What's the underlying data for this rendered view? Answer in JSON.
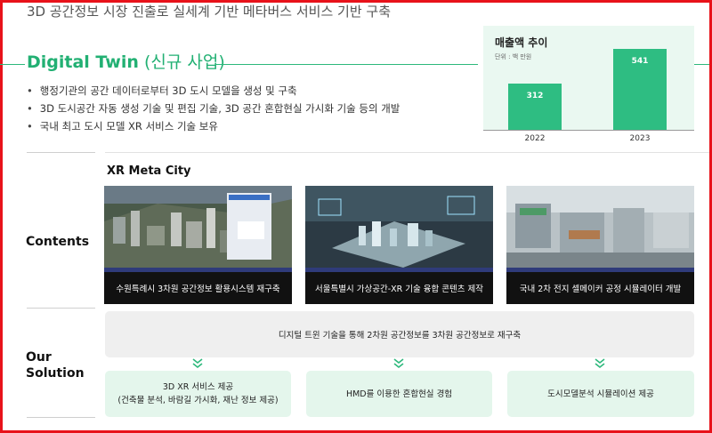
{
  "header": {
    "title": "3D 공간정보 시장 진출로 실세계 기반 메타버스 서비스 기반 구축"
  },
  "section": {
    "title_en": "Digital Twin",
    "title_ko": "(신규 사업)",
    "bullets": [
      "행정기관의 공간 데이터로부터 3D 도시 모델을 생성 및 구축",
      "3D 도시공간 자동 생성 기술 및 편집 기술, 3D 공간 혼합현실 가시화 기술 등의 개발",
      "국내 최고 도시 모델 XR 서비스 기술 보유"
    ]
  },
  "chart_data": {
    "type": "bar",
    "title": "매출액 추이",
    "unit": "단위 : 백 만원",
    "categories": [
      "2022",
      "2023"
    ],
    "values": [
      312,
      541
    ],
    "ylim": [
      0,
      541
    ],
    "colors": {
      "bar": "#2ebd82",
      "background": "#eaf8f1"
    }
  },
  "xr": {
    "title": "XR Meta City"
  },
  "contents": {
    "label": "Contents",
    "cards": [
      {
        "caption": "수원특례시 3차원 공간정보 활용시스템 재구축"
      },
      {
        "caption": "서울특별시 가상공간-XR 기술 융합 콘텐츠 제작"
      },
      {
        "caption": "국내 2차 전지  셀메이커 공정 시뮬레이터 개발"
      }
    ]
  },
  "solution": {
    "label_line1": "Our",
    "label_line2": "Solution",
    "main": "디지털 트윈 기술을 통해 2차원 공간정보를 3차원 공간정보로 재구축",
    "items": [
      {
        "line1": "3D XR 서비스 제공",
        "line2": "(건축물 분석, 바람길 가시화, 재난 정보 제공)"
      },
      {
        "line1": "HMD를 이용한 혼합현실 경험",
        "line2": ""
      },
      {
        "line1": "도시모델분석 시뮬레이션 제공",
        "line2": ""
      }
    ]
  },
  "colors": {
    "accent": "#22b073",
    "frame": "#e8121a"
  }
}
